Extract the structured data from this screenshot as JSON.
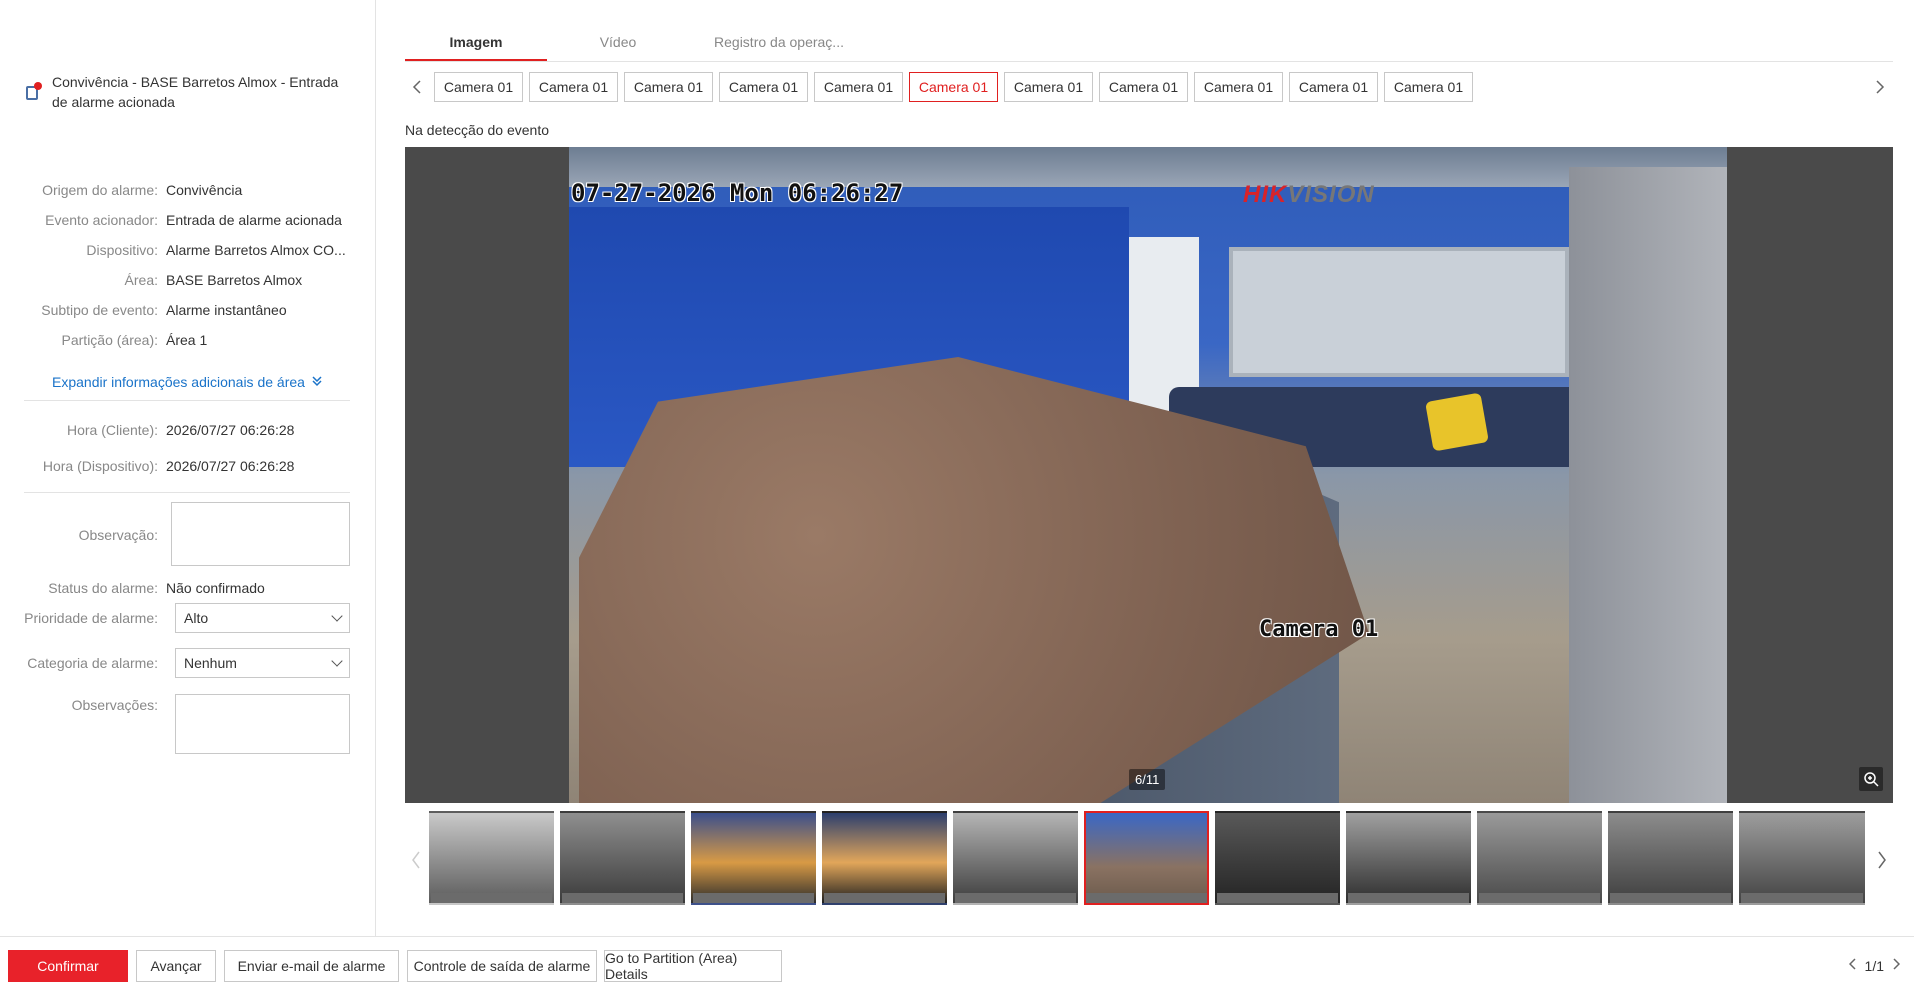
{
  "alarm": {
    "title": "Convivência - BASE Barretos Almox - Entrada de alarme acionada"
  },
  "details": [
    {
      "key": "Origem do alarme:",
      "value": "Convivência"
    },
    {
      "key": "Evento acionador:",
      "value": "Entrada de alarme acionada"
    },
    {
      "key": "Dispositivo:",
      "value": "Alarme Barretos Almox CO..."
    },
    {
      "key": "Área:",
      "value": "BASE Barretos Almox"
    },
    {
      "key": "Subtipo de evento:",
      "value": "Alarme instantâneo"
    },
    {
      "key": "Partição (área):",
      "value": "Área 1"
    }
  ],
  "expand_label": "Expandir informações adicionais de área",
  "times": [
    {
      "key": "Hora (Cliente):",
      "value": "2026/07/27 06:26:28"
    },
    {
      "key": "Hora (Dispositivo):",
      "value": "2026/07/27 06:26:28"
    }
  ],
  "form": {
    "observation_label": "Observação:",
    "observation_value": "",
    "status_label": "Status do alarme:",
    "status_value": "Não confirmado",
    "priority_label": "Prioridade de alarme:",
    "priority_value": "Alto",
    "category_label": "Categoria de alarme:",
    "category_value": "Nenhum",
    "remarks_label": "Observações:",
    "remarks_value": ""
  },
  "tabs": [
    "Imagem",
    "Vídeo",
    "Registro da operaç..."
  ],
  "cameras": [
    "Camera 01",
    "Camera 01",
    "Camera 01",
    "Camera 01",
    "Camera 01",
    "Camera 01",
    "Camera 01",
    "Camera 01",
    "Camera 01",
    "Camera 01",
    "Camera 01"
  ],
  "active_camera_index": 5,
  "caption": "Na detecção do evento",
  "viewer": {
    "osd_timestamp": "07-27-2026 Mon 06:26:27",
    "osd_camera": "Camera 01",
    "brand_red": "HIK",
    "brand_grey": "VISION",
    "counter": "6/11"
  },
  "thumbnails_count": 11,
  "active_thumbnail_index": 5,
  "buttons": {
    "confirm": "Confirmar",
    "next": "Avançar",
    "email": "Enviar e-mail de alarme",
    "output": "Controle de saída de alarme",
    "partition": "Go to Partition (Area) Details"
  },
  "pager": "1/1",
  "colors": {
    "accent": "#e8222a",
    "link": "#1a73c9"
  }
}
